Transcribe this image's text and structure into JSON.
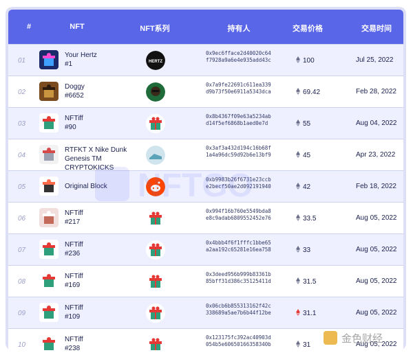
{
  "table": {
    "headers": [
      "#",
      "NFT",
      "NFT系列",
      "持有人",
      "交易价格",
      "交易时间"
    ],
    "rows": [
      {
        "rank": "01",
        "name": [
          "Your Hertz",
          "#1"
        ],
        "collection_icon": "hertz-logo-icon",
        "holder": "0x9ec6fface2d40020c64f7928a9a6e4e935add43c",
        "price": "100",
        "date": "Jul 25, 2022"
      },
      {
        "rank": "02",
        "name": [
          "Doggy",
          "#6652"
        ],
        "collection_icon": "doggy-collection-icon",
        "holder": "0x7a9fe22691c611ea339d9b73f50e6911a5343dca",
        "price": "69.42",
        "date": "Feb 28, 2022"
      },
      {
        "rank": "03",
        "name": [
          "NFTiff",
          "#90"
        ],
        "collection_icon": "gift-box-icon",
        "holder": "0x8b4367f09e63a5234abd14f5ef6868b1aed0e7d",
        "price": "55",
        "date": "Aug 04, 2022"
      },
      {
        "rank": "04",
        "name": [
          "RTFKT X Nike Dunk",
          "Genesis TM CRYPTOKICKS"
        ],
        "collection_icon": "sneaker-collection-icon",
        "holder": "0x3af3a432d194c16b68f1a4a96dc59d92b6e13bf9",
        "price": "45",
        "date": "Apr 23, 2022"
      },
      {
        "rank": "05",
        "name": [
          "Original Block"
        ],
        "collection_icon": "reddit-icon",
        "holder": "0xb9983b26f6731e23ccbe2becf50ae2d092191940",
        "price": "42",
        "date": "Feb 18, 2022"
      },
      {
        "rank": "06",
        "name": [
          "NFTiff",
          "#217"
        ],
        "collection_icon": "gift-box-icon",
        "holder": "0x994f16b760e5549bda8e8c9adab6809552452e76",
        "price": "33.5",
        "date": "Aug 05, 2022"
      },
      {
        "rank": "07",
        "name": [
          "NFTiff",
          "#236"
        ],
        "collection_icon": "gift-box-icon",
        "holder": "0x4bbb4f6f1fffc1bbe65a2aa192c65281e16ea758",
        "price": "33",
        "date": "Aug 05, 2022"
      },
      {
        "rank": "08",
        "name": [
          "NFTiff",
          "#169"
        ],
        "collection_icon": "gift-box-icon",
        "holder": "0x3deed956b999b83361b85bff31d386c35125411d",
        "price": "31.5",
        "date": "Aug 05, 2022"
      },
      {
        "rank": "09",
        "name": [
          "NFTiff",
          "#109"
        ],
        "collection_icon": "gift-box-icon",
        "holder": "0x06cb6b855313162f42c338689a5ae7b6b44f12be",
        "price": "31.1",
        "date": "Aug 05, 2022",
        "price_color": "red"
      },
      {
        "rank": "10",
        "name": [
          "NFTiff",
          "#238"
        ],
        "collection_icon": "gift-box-icon",
        "holder": "0x123175fc392ac40903d054b5e60650166358340b",
        "price": "31",
        "date": "Aug 05, 2022"
      }
    ]
  },
  "watermark": {
    "text": "NFTGO"
  },
  "corner_logo": {
    "text": "金色财经"
  },
  "colors": {
    "header_bg": "#5a66e8",
    "row_alt": "#eef0ff",
    "frame": "#dcdff5",
    "eth_default": "#6b6f8a",
    "eth_red": "#e53935"
  }
}
